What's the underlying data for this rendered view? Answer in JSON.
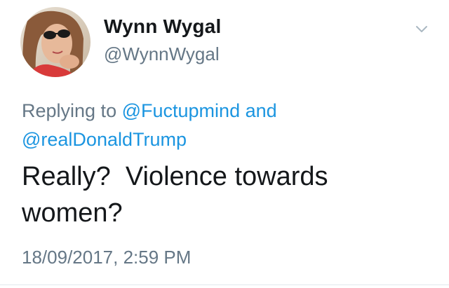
{
  "user": {
    "display_name": "Wynn Wygal",
    "handle": "@WynnWygal",
    "avatar_icon": "profile-photo"
  },
  "reply_context": {
    "prefix": "Replying to",
    "mention_1": "@Fuctupmind",
    "conjunction": "and",
    "mention_2": "@realDonaldTrump"
  },
  "tweet": {
    "text_line_1": "Really?  Violence towards",
    "text_line_2": "women?",
    "timestamp": "18/09/2017, 2:59 PM"
  },
  "icons": {
    "menu": "chevron-down-icon"
  },
  "colors": {
    "link": "#1b95e0",
    "secondary_text": "#657786",
    "primary_text": "#14171a"
  }
}
